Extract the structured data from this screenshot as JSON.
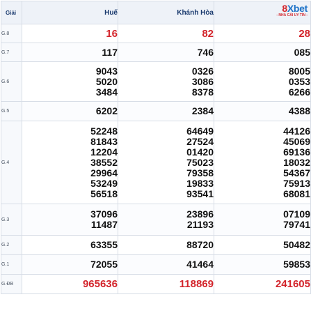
{
  "header": {
    "giai_label": "Giải",
    "provinces": [
      "Huế",
      "Khánh Hòa"
    ]
  },
  "logo": {
    "brand_prefix": "8",
    "brand_rest": "Xbet",
    "tagline": "- NHÀ CÁI UY TÍN -",
    "colors": {
      "blue": "#1e73c8",
      "red": "#d3242b"
    }
  },
  "rows": [
    {
      "label": "G.8",
      "values": [
        [
          "16"
        ],
        [
          "82"
        ],
        [
          "28"
        ]
      ]
    },
    {
      "label": "G.7",
      "values": [
        [
          "117"
        ],
        [
          "746"
        ],
        [
          "085"
        ]
      ]
    },
    {
      "label": "G.6",
      "values": [
        [
          "9043",
          "5020",
          "3484"
        ],
        [
          "0326",
          "3086",
          "8378"
        ],
        [
          "8005",
          "0353",
          "6266"
        ]
      ]
    },
    {
      "label": "G.5",
      "values": [
        [
          "6202"
        ],
        [
          "2384"
        ],
        [
          "4388"
        ]
      ]
    },
    {
      "label": "G.4",
      "values": [
        [
          "52248",
          "81843",
          "12204",
          "38552",
          "29964",
          "53249",
          "56518"
        ],
        [
          "64649",
          "27524",
          "01420",
          "75023",
          "79358",
          "19833",
          "93541"
        ],
        [
          "44126",
          "45069",
          "69136",
          "18032",
          "54367",
          "75913",
          "68081"
        ]
      ]
    },
    {
      "label": "G.3",
      "values": [
        [
          "37096",
          "11487"
        ],
        [
          "23896",
          "21193"
        ],
        [
          "07109",
          "79741"
        ]
      ]
    },
    {
      "label": "G.2",
      "values": [
        [
          "63355"
        ],
        [
          "88720"
        ],
        [
          "50482"
        ]
      ]
    },
    {
      "label": "G.1",
      "values": [
        [
          "72055"
        ],
        [
          "41464"
        ],
        [
          "59853"
        ]
      ]
    },
    {
      "label": "G.ĐB",
      "values": [
        [
          "965636"
        ],
        [
          "118869"
        ],
        [
          "241605"
        ]
      ]
    }
  ],
  "accent_red": "#d3242b"
}
